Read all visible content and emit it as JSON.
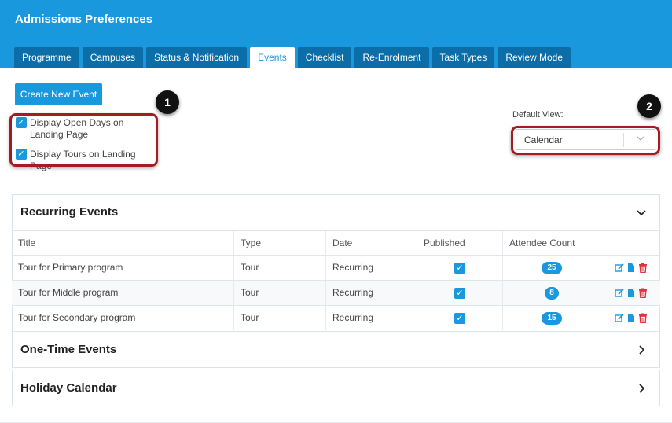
{
  "header": {
    "title": "Admissions Preferences",
    "tabs": [
      {
        "label": "Programme",
        "active": false
      },
      {
        "label": "Campuses",
        "active": false
      },
      {
        "label": "Status & Notification",
        "active": false
      },
      {
        "label": "Events",
        "active": true
      },
      {
        "label": "Checklist",
        "active": false
      },
      {
        "label": "Re-Enrolment",
        "active": false
      },
      {
        "label": "Task Types",
        "active": false
      },
      {
        "label": "Review Mode",
        "active": false
      }
    ]
  },
  "toolbar": {
    "create_label": "Create New Event"
  },
  "callouts": {
    "one": "1",
    "two": "2"
  },
  "options": {
    "open_days_label": "Display Open Days on Landing Page",
    "open_days_checked": true,
    "tours_label": "Display Tours on Landing Page",
    "tours_checked": true
  },
  "default_view": {
    "label": "Default View:",
    "value": "Calendar"
  },
  "recurring": {
    "title": "Recurring Events",
    "columns": {
      "title": "Title",
      "type": "Type",
      "date": "Date",
      "published": "Published",
      "attendee_count": "Attendee Count"
    },
    "rows": [
      {
        "title": "Tour for Primary program",
        "type": "Tour",
        "date": "Recurring",
        "published": true,
        "count": "25"
      },
      {
        "title": "Tour for Middle program",
        "type": "Tour",
        "date": "Recurring",
        "published": true,
        "count": "8"
      },
      {
        "title": "Tour for Secondary program",
        "type": "Tour",
        "date": "Recurring",
        "published": true,
        "count": "15"
      }
    ]
  },
  "one_time": {
    "title": "One-Time Events"
  },
  "holiday": {
    "title": "Holiday Calendar"
  },
  "colors": {
    "brand": "#1a98de",
    "tab_inactive": "#0b6ea9",
    "callout": "#a31c22",
    "delete": "#d9363e"
  },
  "icons": {
    "checkbox": "check-icon",
    "edit": "edit-icon",
    "copy": "document-icon",
    "delete": "trash-icon",
    "expand": "chevron-down-icon",
    "collapse": "chevron-right-icon"
  }
}
